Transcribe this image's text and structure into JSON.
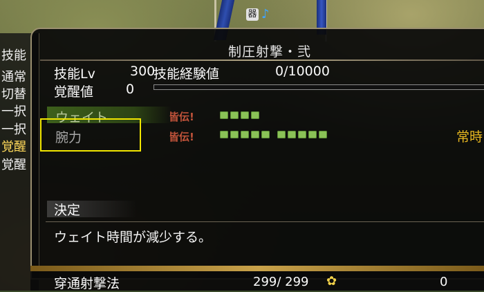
{
  "left_list": {
    "title": "技能",
    "items": [
      "通常",
      "切替",
      "一択",
      "一択",
      "覚醒",
      "覚醒"
    ]
  },
  "hud": {
    "icon_a": "器",
    "icon_b": "♪"
  },
  "skill": {
    "title": "制圧射撃・弐",
    "lv_label": "技能Lv",
    "lv_value": "300",
    "exp_label": "技能経験値",
    "exp_value": "0/10000",
    "exp_progress": 0,
    "kakusei_label": "覚醒値",
    "kakusei_value": "0"
  },
  "rows": [
    {
      "label": "ウェイト",
      "kaiden": "皆伝!",
      "pips": 4,
      "highlighted": true
    },
    {
      "label": "腕力",
      "kaiden": "皆伝!",
      "pips": 10,
      "highlighted": false,
      "selected": true,
      "extra": "常時"
    }
  ],
  "decide_label": "決定",
  "description": "ウェイト時間が減少する。",
  "bottom_row": {
    "label": "穿通射撃法",
    "value": "299/ 299",
    "icon": "flower-icon",
    "extra": "0"
  },
  "colors": {
    "pip": "#8ac257",
    "kaiden": "#c0533a",
    "jouji": "#e8b820",
    "selection": "#f2e600"
  }
}
